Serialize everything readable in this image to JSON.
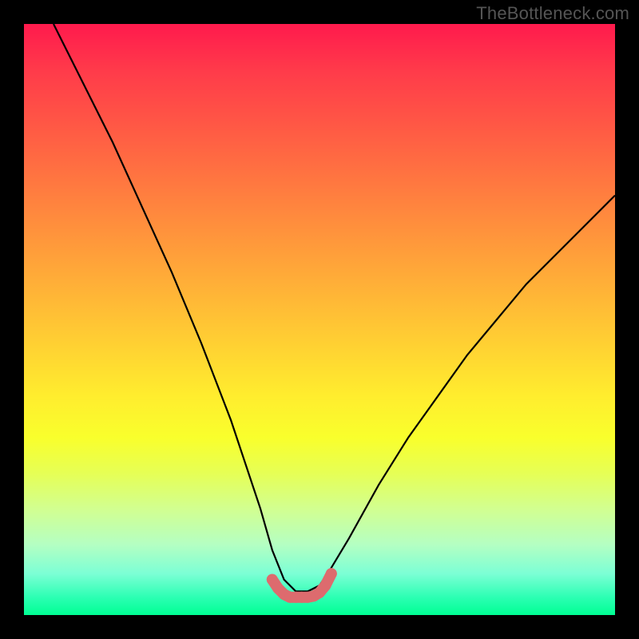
{
  "attribution": "TheBottleneck.com",
  "chart_data": {
    "type": "line",
    "title": "",
    "xlabel": "",
    "ylabel": "",
    "xlim": [
      0,
      100
    ],
    "ylim": [
      0,
      100
    ],
    "grid": false,
    "legend": false,
    "note": "Axis values are unlabeled in the source image; x and y are normalized 0–100. Higher y = red (worse), lower y = green (better). The black curve dips to a minimum near x≈46, with a small pink marker band at the bottom.",
    "series": [
      {
        "name": "bottleneck-curve",
        "color": "#000000",
        "x": [
          5,
          10,
          15,
          20,
          25,
          30,
          35,
          40,
          42,
          44,
          46,
          48,
          50,
          52,
          55,
          60,
          65,
          70,
          75,
          80,
          85,
          90,
          95,
          100
        ],
        "y": [
          100,
          90,
          80,
          69,
          58,
          46,
          33,
          18,
          11,
          6,
          4,
          4,
          5,
          8,
          13,
          22,
          30,
          37,
          44,
          50,
          56,
          61,
          66,
          71
        ]
      },
      {
        "name": "optimal-band-markers",
        "color": "#dd6b6e",
        "x": [
          42,
          43,
          44,
          45,
          46,
          47,
          48,
          49,
          50,
          51,
          52
        ],
        "y": [
          6,
          4.5,
          3.5,
          3,
          3,
          3,
          3,
          3.2,
          3.8,
          5,
          7
        ]
      }
    ],
    "background_gradient_stops": [
      {
        "pos": 0,
        "color": "#ff1a4d"
      },
      {
        "pos": 50,
        "color": "#ffd332"
      },
      {
        "pos": 75,
        "color": "#f2ff40"
      },
      {
        "pos": 100,
        "color": "#00ff94"
      }
    ]
  }
}
